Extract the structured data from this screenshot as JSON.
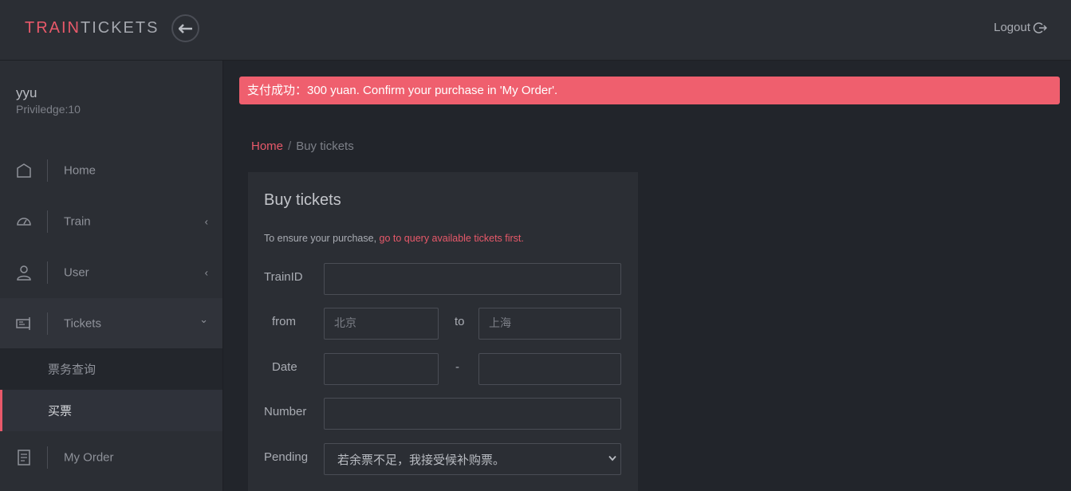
{
  "header": {
    "logo_part1": "TRAIN",
    "logo_part2": "TICKETS",
    "back_icon": "arrow-left-icon",
    "logout_label": "Logout",
    "logout_icon": "logout-icon"
  },
  "user": {
    "name": "yyu",
    "privilege": "Priviledge:10"
  },
  "sidebar": {
    "items": [
      {
        "label": "Home",
        "icon": "home-icon"
      },
      {
        "label": "Train",
        "icon": "gauge-icon",
        "chevron": "‹"
      },
      {
        "label": "User",
        "icon": "user-icon",
        "chevron": "‹"
      },
      {
        "label": "Tickets",
        "icon": "ticket-icon",
        "chevron": "⌄"
      },
      {
        "label": "My Order",
        "icon": "receipt-icon"
      }
    ],
    "sub_items": [
      {
        "label": "票务查询"
      },
      {
        "label": "买票"
      }
    ]
  },
  "alert": {
    "text": "支付成功：300 yuan. Confirm your purchase in 'My Order'."
  },
  "breadcrumb": {
    "home": "Home",
    "separator": "/",
    "current": "Buy tickets"
  },
  "form": {
    "title": "Buy tickets",
    "hint_prefix": "To ensure your purchase, ",
    "hint_link": "go to query available tickets first.",
    "train_id_label": "TrainID",
    "train_id_value": "",
    "from_label": "from",
    "from_placeholder": "北京",
    "to_label": "to",
    "to_placeholder": "上海",
    "date_label": "Date",
    "date_sep": "-",
    "date_start": "",
    "date_end": "",
    "number_label": "Number",
    "number_value": "",
    "pending_label": "Pending",
    "pending_value": "若余票不足，我接受候补购票。"
  },
  "colors": {
    "accent": "#e8596a",
    "alert_bg": "#ef5f6e",
    "bg": "#22252b",
    "panel": "#2b2e34"
  }
}
